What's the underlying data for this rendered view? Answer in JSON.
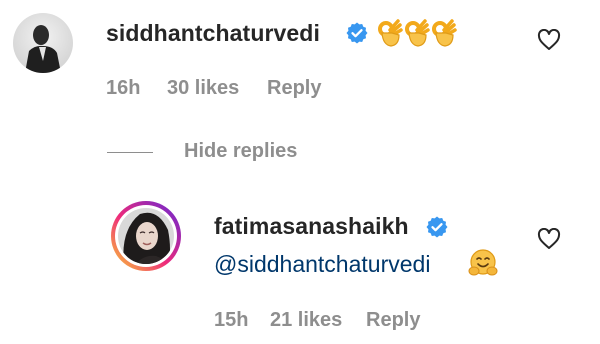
{
  "comment": {
    "username": "siddhantchaturvedi",
    "verified": true,
    "emoji": [
      "ok-hand",
      "ok-hand",
      "ok-hand"
    ],
    "time": "16h",
    "likes": "30 likes",
    "reply": "Reply"
  },
  "hide_replies": "Hide replies",
  "reply": {
    "username": "fatimasanashaikh",
    "verified": true,
    "mention": "@siddhantchaturvedi",
    "emoji": [
      "hugging-face"
    ],
    "time": "15h",
    "likes": "21 likes",
    "reply": "Reply",
    "has_story_ring": true
  },
  "colors": {
    "username": "#262626",
    "meta": "#8e8e8e",
    "mention": "#00376b",
    "verified": "#3897f0"
  }
}
